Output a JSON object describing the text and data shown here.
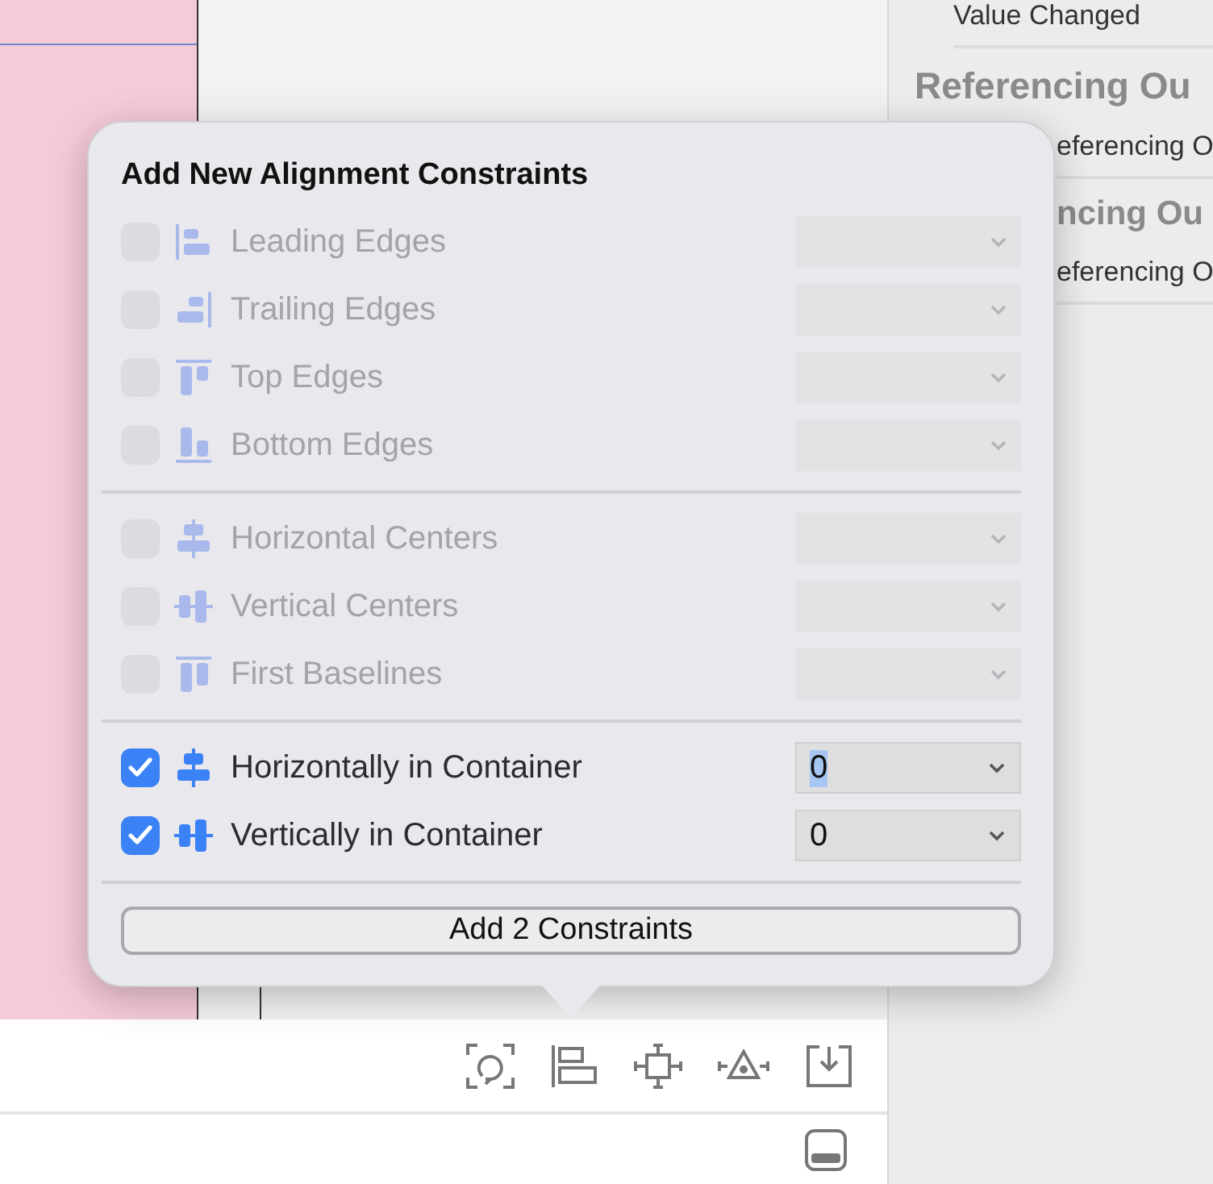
{
  "inspector": {
    "items": [
      {
        "kind": "row",
        "text": "Value Changed"
      },
      {
        "kind": "heading",
        "text": "Referencing Ou"
      },
      {
        "kind": "row",
        "text": "eferencing O",
        "covered": true
      },
      {
        "kind": "heading",
        "text": "ncing Ou",
        "covered": true
      },
      {
        "kind": "row",
        "text": "eferencing O",
        "covered": true
      }
    ]
  },
  "popover": {
    "title": "Add New Alignment Constraints",
    "groups": [
      [
        {
          "kind": "leading",
          "label": "Leading Edges",
          "checked": false,
          "disabled": true
        },
        {
          "kind": "trailing",
          "label": "Trailing Edges",
          "checked": false,
          "disabled": true
        },
        {
          "kind": "top",
          "label": "Top Edges",
          "checked": false,
          "disabled": true
        },
        {
          "kind": "bottom",
          "label": "Bottom Edges",
          "checked": false,
          "disabled": true
        }
      ],
      [
        {
          "kind": "hcenter",
          "label": "Horizontal Centers",
          "checked": false,
          "disabled": true
        },
        {
          "kind": "vcenter",
          "label": "Vertical Centers",
          "checked": false,
          "disabled": true
        },
        {
          "kind": "baseline",
          "label": "First Baselines",
          "checked": false,
          "disabled": true
        }
      ],
      [
        {
          "kind": "hcenter",
          "label": "Horizontally in Container",
          "checked": true,
          "disabled": false,
          "value": "0",
          "value_selected": true
        },
        {
          "kind": "vcenter",
          "label": "Vertically in Container",
          "checked": true,
          "disabled": false,
          "value": "0",
          "value_selected": false
        }
      ]
    ],
    "button": "Add 2 Constraints"
  },
  "toolbar": {
    "tools": [
      {
        "kind": "refresh"
      },
      {
        "kind": "align"
      },
      {
        "kind": "pin"
      },
      {
        "kind": "resolve"
      },
      {
        "kind": "embed"
      }
    ]
  },
  "bottom_bar": {
    "tools": [
      {
        "kind": "panel"
      }
    ]
  }
}
